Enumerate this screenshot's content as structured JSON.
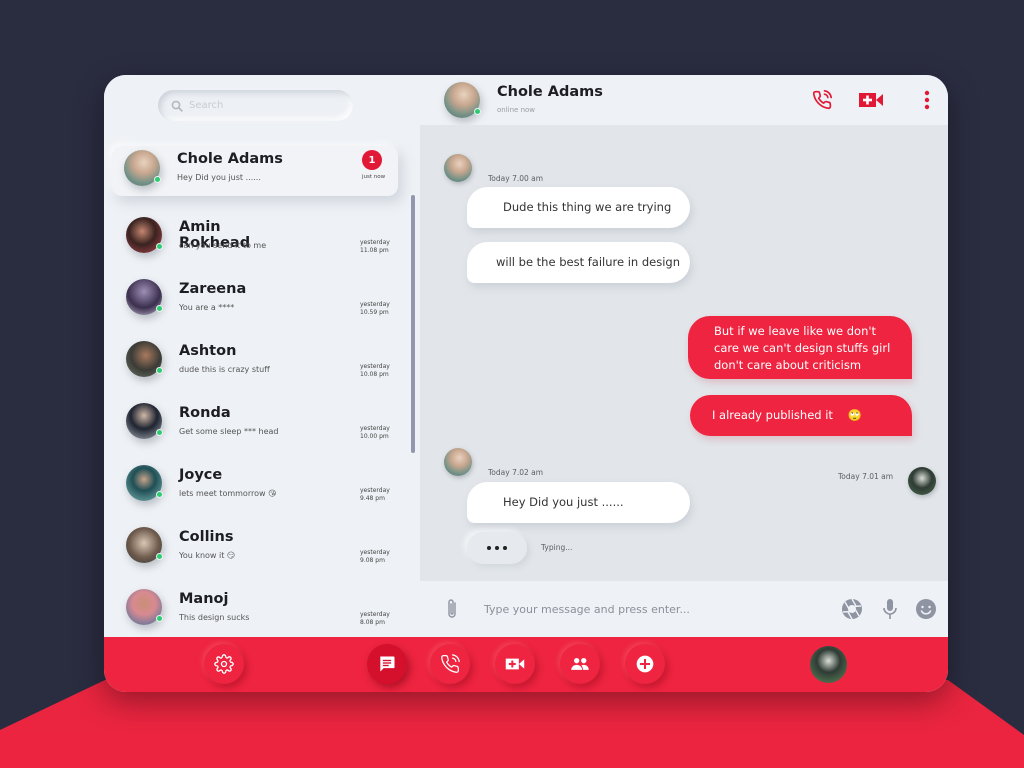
{
  "sidebar": {
    "search_placeholder": "Search",
    "chats": [
      {
        "name": "Chole Adams",
        "preview": "Hey Did you just ......",
        "time": "just now",
        "unread": "1",
        "online": true,
        "active": true,
        "avatar_colors": [
          "#c9a78f",
          "#6b8f86"
        ]
      },
      {
        "name": "Amin Rokhead",
        "preview": "can you send it to me",
        "time_day": "yesterday",
        "time": "11.08 pm",
        "online": true,
        "avatar_colors": [
          "#3a2320",
          "#b0464f"
        ]
      },
      {
        "name": "Zareena",
        "preview": "You are a ****",
        "time_day": "yesterday",
        "time": "10.59 pm",
        "online": true,
        "avatar_colors": [
          "#3b2f4e",
          "#9d8fb5"
        ]
      },
      {
        "name": "Ashton",
        "preview": "dude this is crazy stuff",
        "time_day": "yesterday",
        "time": "10.08 pm",
        "online": true,
        "avatar_colors": [
          "#3b3b36",
          "#8a6852"
        ]
      },
      {
        "name": "Ronda",
        "preview": "Get some sleep *** head",
        "time_day": "yesterday",
        "time": "10.00 pm",
        "online": true,
        "avatar_colors": [
          "#1e2430",
          "#a8b0b8"
        ]
      },
      {
        "name": "Joyce",
        "preview": "lets meet tommorrow",
        "emoji": "😘",
        "time_day": "yesterday",
        "time": "9.48 pm",
        "online": true,
        "avatar_colors": [
          "#1f4f55",
          "#7fb5b5"
        ]
      },
      {
        "name": "Collins",
        "preview": "You know it",
        "emoji": "😏",
        "time_day": "yesterday",
        "time": "9.08 pm",
        "online": true,
        "avatar_colors": [
          "#6e5a4c",
          "#d9c7b4"
        ]
      },
      {
        "name": "Manoj",
        "preview": "This design sucks",
        "time_day": "yesterday",
        "time": "8.08 pm",
        "online": true,
        "avatar_colors": [
          "#d88a91",
          "#3e6ea0"
        ]
      }
    ]
  },
  "header": {
    "name": "Chole Adams",
    "status": "online now",
    "icons": [
      "phone-call-icon",
      "video-call-icon",
      "more-vertical-icon"
    ]
  },
  "messages": [
    {
      "direction": "in",
      "time": "Today 7.00 am",
      "bubbles": [
        "Dude this thing we are trying",
        "will be the best failure in design"
      ]
    },
    {
      "direction": "out",
      "time": "Today 7.01 am",
      "bubbles": [
        "But if we leave like we don't care we can't design stuffs girl don't care about criticism",
        "I already published it"
      ],
      "emoji": "🙄"
    },
    {
      "direction": "in",
      "time": "Today 7.02 am",
      "bubbles": [
        "Hey Did you just ......"
      ]
    }
  ],
  "typing": {
    "text": "Typing..."
  },
  "composer": {
    "placeholder": "Type your message and press enter...",
    "icons": [
      "paperclip-icon",
      "camera-shutter-icon",
      "microphone-icon",
      "emoji-icon"
    ]
  },
  "bottom_nav": {
    "items": [
      "settings",
      "messages",
      "calls",
      "video",
      "contacts",
      "add"
    ],
    "active": "messages"
  },
  "colors": {
    "accent": "#ee2440",
    "badge": "#e11936",
    "online": "#2ecc71",
    "background": "#2a2c40",
    "panel": "#eef1f5",
    "chat_bg": "#e2e6ea"
  }
}
